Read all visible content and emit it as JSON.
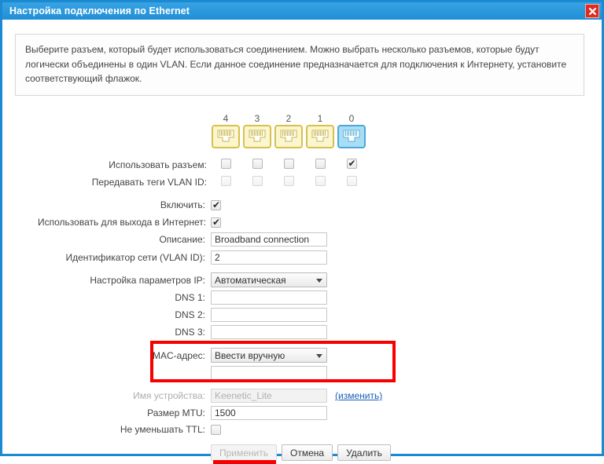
{
  "window": {
    "title": "Настройка подключения по Ethernet",
    "close_icon": "close-icon",
    "accent_color": "#1b8ad0",
    "close_color": "#e02b20",
    "annotation_color": "#f80000"
  },
  "info": {
    "text": "Выберите разъем, который будет использоваться соединением. Можно выбрать несколько разъемов, которые будут логически объединены в один VLAN. Если данное соединение предназначается для подключения к Интернету, установите соответствующий флажок."
  },
  "ports": {
    "numbers": [
      "4",
      "3",
      "2",
      "1",
      "0"
    ],
    "kinds": [
      "lan",
      "lan",
      "lan",
      "lan",
      "wan"
    ],
    "lan_color": "#fbf6cf",
    "wan_color": "#a9ddf5",
    "rows": [
      {
        "label": "Использовать разъем:",
        "checked": [
          false,
          false,
          false,
          false,
          true
        ],
        "disabled": false
      },
      {
        "label": "Передавать теги VLAN ID:",
        "checked": [
          false,
          false,
          false,
          false,
          false
        ],
        "disabled": true
      }
    ]
  },
  "form": {
    "enable": {
      "label": "Включить:",
      "checked": true
    },
    "internet": {
      "label": "Использовать для выхода в Интернет:",
      "checked": true
    },
    "description": {
      "label": "Описание:",
      "value": "Broadband connection",
      "placeholder": ""
    },
    "vlan": {
      "label": "Идентификатор сети (VLAN ID):",
      "value": "2",
      "placeholder": ""
    },
    "ip_config": {
      "label": "Настройка параметров IP:",
      "value": "Автоматическая"
    },
    "dns1": {
      "label": "DNS 1:",
      "value": "",
      "placeholder": ""
    },
    "dns2": {
      "label": "DNS 2:",
      "value": "",
      "placeholder": ""
    },
    "dns3": {
      "label": "DNS 3:",
      "value": "",
      "placeholder": ""
    },
    "mac": {
      "label": "MAC-адрес:",
      "value": "Ввести вручную"
    },
    "mac_input": {
      "value": "",
      "placeholder": ""
    },
    "device_name": {
      "label": "Имя устройства:",
      "value": "Keenetic_Lite",
      "link": "(изменить)"
    },
    "mtu": {
      "label": "Размер MTU:",
      "value": "1500",
      "placeholder": ""
    },
    "ttl": {
      "label": "Не уменьшать TTL:",
      "checked": false
    }
  },
  "buttons": {
    "apply": "Применить",
    "cancel": "Отмена",
    "delete": "Удалить"
  }
}
